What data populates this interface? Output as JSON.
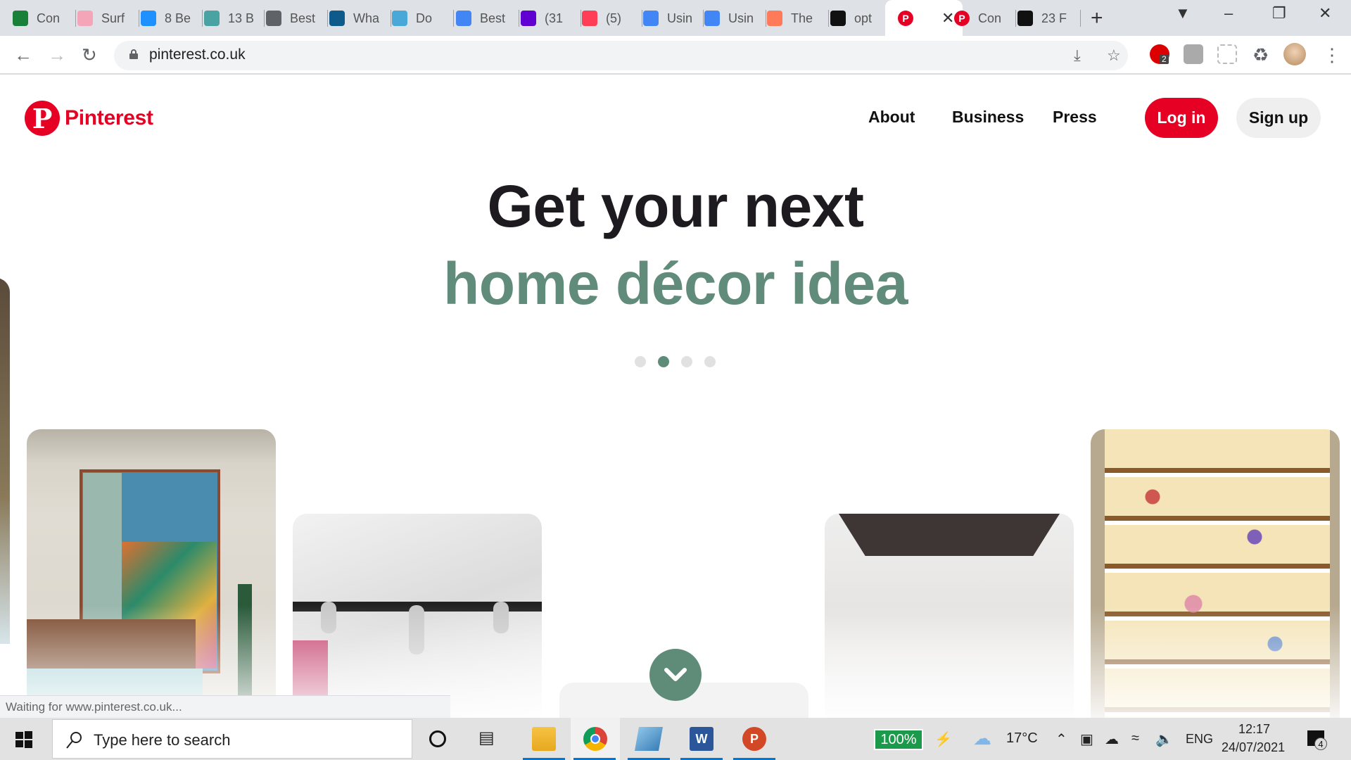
{
  "browser": {
    "tabs": [
      {
        "label": "Con",
        "icon": "google-sheets-icon",
        "color": "#188038"
      },
      {
        "label": "Surf",
        "icon": "survey-icon",
        "color": "#f4a6b8"
      },
      {
        "label": "8 Be",
        "icon": "water-drop-icon",
        "color": "#1e90ff"
      },
      {
        "label": "13 B",
        "icon": "water-filter-icon",
        "color": "#4aa3a3"
      },
      {
        "label": "Best",
        "icon": "globe-icon",
        "color": "#5f6368"
      },
      {
        "label": "Wha",
        "icon": "h-logo-icon",
        "color": "#0e5a8a"
      },
      {
        "label": "Do",
        "icon": "triangle-logo-icon",
        "color": "#4aa8d8"
      },
      {
        "label": "Best",
        "icon": "google-docs-icon",
        "color": "#4285f4"
      },
      {
        "label": "(31",
        "icon": "mail-icon",
        "color": "#6001d2"
      },
      {
        "label": "(5)",
        "icon": "monday-icon",
        "color": "#ff3d57"
      },
      {
        "label": "Usin",
        "icon": "google-docs-icon",
        "color": "#4285f4"
      },
      {
        "label": "Usin",
        "icon": "google-docs-icon",
        "color": "#4285f4"
      },
      {
        "label": "The",
        "icon": "hubspot-icon",
        "color": "#ff7a59"
      },
      {
        "label": "opt",
        "icon": "o-logo-icon",
        "color": "#111111"
      },
      {
        "label": "",
        "icon": "pinterest-icon",
        "color": "#e60023",
        "active": true
      },
      {
        "label": "Con",
        "icon": "pinterest-icon",
        "color": "#e60023"
      },
      {
        "label": "23 F",
        "icon": "hootsuite-owl-icon",
        "color": "#111111"
      }
    ],
    "url": "pinterest.co.uk",
    "extension_badge": "2",
    "status_text": "Waiting for www.pinterest.co.uk..."
  },
  "page": {
    "brand": "Pinterest",
    "brand_color": "#e60023",
    "accent_color": "#5e8c78",
    "nav": [
      "About",
      "Business",
      "Press"
    ],
    "login_label": "Log in",
    "signup_label": "Sign up",
    "headline_line1": "Get your next",
    "headline_line2": "home décor idea",
    "carousel": {
      "total": 4,
      "active_index": 1
    },
    "cards": [
      {
        "subject": "bedroom with colorful painting"
      },
      {
        "subject": "marble bathroom taps"
      },
      {
        "subject": "blank"
      },
      {
        "subject": "white hallway"
      },
      {
        "subject": "floral wallpaper staircase"
      }
    ]
  },
  "taskbar": {
    "search_placeholder": "Type here to search",
    "battery": "100%",
    "temperature": "17°C",
    "language": "ENG",
    "time": "12:17",
    "date": "24/07/2021",
    "notifications": "4"
  }
}
